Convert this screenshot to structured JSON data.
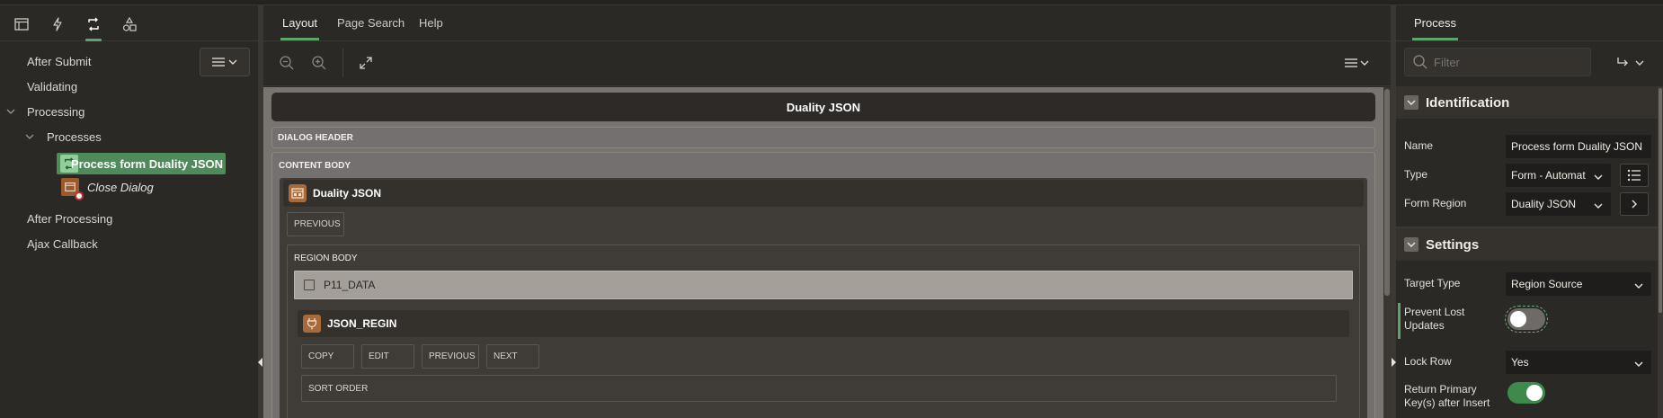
{
  "left": {
    "tree": [
      {
        "label": "After Submit"
      },
      {
        "label": "Validating"
      },
      {
        "label": "Processing"
      },
      {
        "label": "Processes"
      },
      {
        "label": "Process form Duality JSON"
      },
      {
        "label": "Close Dialog"
      },
      {
        "label": "After Processing"
      },
      {
        "label": "Ajax Callback"
      }
    ]
  },
  "center": {
    "tabs": [
      "Layout",
      "Page Search",
      "Help"
    ],
    "page_title": "Duality JSON",
    "dialog_header": "DIALOG HEADER",
    "content_body": "CONTENT BODY",
    "region": {
      "title": "Duality JSON",
      "previous": "PREVIOUS",
      "body_label": "REGION BODY",
      "item": "P11_DATA"
    },
    "inner_region": {
      "title": "JSON_REGIN",
      "buttons": [
        "COPY",
        "EDIT",
        "PREVIOUS",
        "NEXT"
      ],
      "sort_order": "SORT ORDER"
    }
  },
  "right": {
    "tab": "Process",
    "filter_placeholder": "Filter",
    "identification": {
      "title": "Identification",
      "name_label": "Name",
      "name_value": "Process form Duality JSON",
      "type_label": "Type",
      "type_value": "Form - Automat",
      "form_region_label": "Form Region",
      "form_region_value": "Duality JSON"
    },
    "settings": {
      "title": "Settings",
      "target_type_label": "Target Type",
      "target_type_value": "Region Source",
      "prevent_lost_label_1": "Prevent Lost",
      "prevent_lost_label_2": "Updates",
      "prevent_lost_on": false,
      "lock_row_label": "Lock Row",
      "lock_row_value": "Yes",
      "return_pk_label_1": "Return Primary",
      "return_pk_label_2": "Key(s) after Insert",
      "return_pk_on": true
    }
  },
  "colors": {
    "accent": "#5fa36a",
    "selected_row": "#4e8a5a",
    "toggle_on": "#3e8a4c"
  }
}
